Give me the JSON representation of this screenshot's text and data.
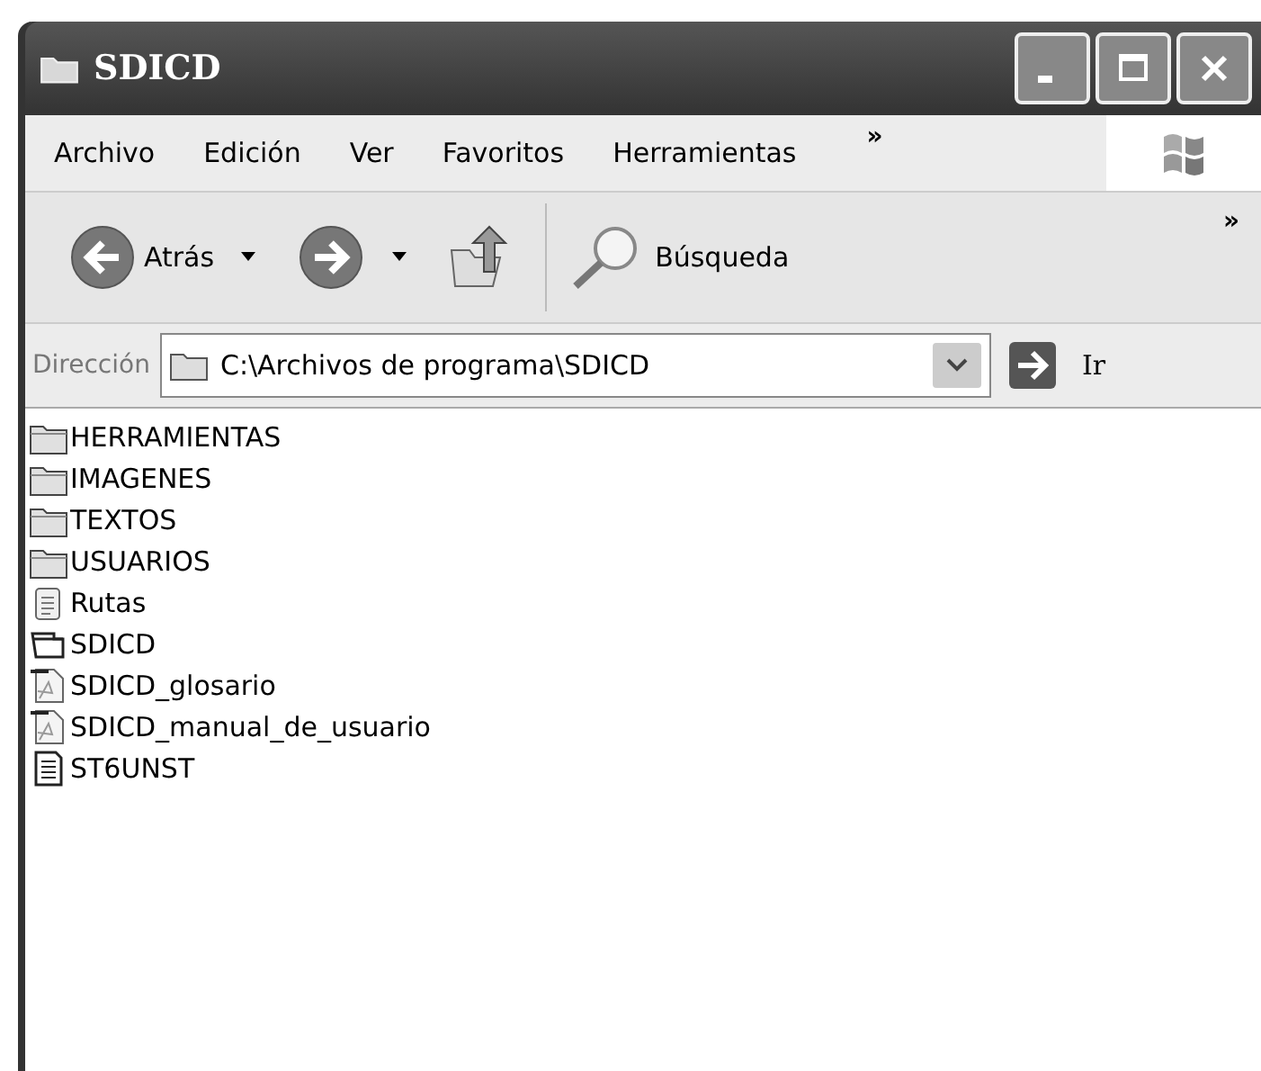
{
  "window": {
    "title": "SDICD"
  },
  "menu": [
    "Archivo",
    "Edición",
    "Ver",
    "Favoritos",
    "Herramientas"
  ],
  "menu_more": "»",
  "toolbar": {
    "back": "Atrás",
    "search": "Búsqueda",
    "more": "»"
  },
  "address": {
    "label": "Dirección",
    "value": "C:\\Archivos de programa\\SDICD",
    "go": "Ir"
  },
  "files": [
    {
      "name": "HERRAMIENTAS",
      "kind": "folder"
    },
    {
      "name": "IMAGENES",
      "kind": "folder"
    },
    {
      "name": "TEXTOS",
      "kind": "folder"
    },
    {
      "name": "USUARIOS",
      "kind": "folder"
    },
    {
      "name": "Rutas",
      "kind": "notepad"
    },
    {
      "name": "SDICD",
      "kind": "program"
    },
    {
      "name": "SDICD_glosario",
      "kind": "pdf"
    },
    {
      "name": "SDICD_manual_de_usuario",
      "kind": "pdf"
    },
    {
      "name": "ST6UNST",
      "kind": "text"
    }
  ]
}
